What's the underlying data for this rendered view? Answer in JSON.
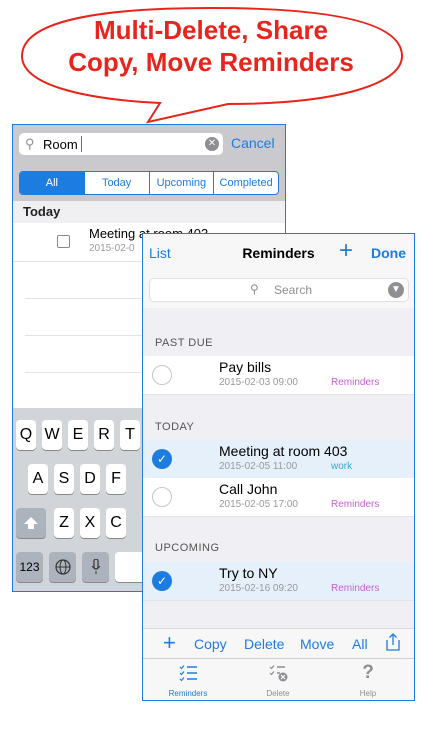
{
  "banner": {
    "line1": "Multi-Delete, Share",
    "line2": "Copy, Move Reminders"
  },
  "colors": {
    "accent": "#1c7ce0",
    "banner_red": "#e8251c",
    "tag_purple": "#c75dd6",
    "tag_blue": "#35a7d8"
  },
  "back_screen": {
    "search_value": "Room",
    "cancel_label": "Cancel",
    "segments": [
      "All",
      "Today",
      "Upcoming",
      "Completed"
    ],
    "section": "Today",
    "row": {
      "title": "Meeting at room 403",
      "date": "2015-02-0"
    },
    "keyboard": {
      "row1": [
        "Q",
        "W",
        "E",
        "R",
        "T"
      ],
      "row2": [
        "A",
        "S",
        "D",
        "F"
      ],
      "row3": [
        "Z",
        "X",
        "C"
      ],
      "num_key": "123"
    }
  },
  "front_screen": {
    "nav": {
      "left": "List",
      "title": "Reminders",
      "plus": "+",
      "done": "Done"
    },
    "search_placeholder": "Search",
    "sections": {
      "past_due": "PAST DUE",
      "today": "TODAY",
      "upcoming": "UPCOMING"
    },
    "items": [
      {
        "title": "Pay bills",
        "date": "2015-02-03 09:00",
        "list": "Reminders",
        "selected": false
      },
      {
        "title": "Meeting at room 403",
        "date": "2015-02-05 11:00",
        "list": "work",
        "selected": true
      },
      {
        "title": "Call John",
        "date": "2015-02-05 17:00",
        "list": "Reminders",
        "selected": false
      },
      {
        "title": "Try to NY",
        "date": "2015-02-16 09:20",
        "list": "Reminders",
        "selected": true
      }
    ],
    "actions": {
      "add": "+",
      "copy": "Copy",
      "delete": "Delete",
      "move": "Move",
      "all": "All"
    },
    "tabs": [
      {
        "label": "Reminders",
        "icon": "list-icon"
      },
      {
        "label": "Delete",
        "icon": "delete-list-icon"
      },
      {
        "label": "Help",
        "icon": "question-icon"
      }
    ]
  }
}
